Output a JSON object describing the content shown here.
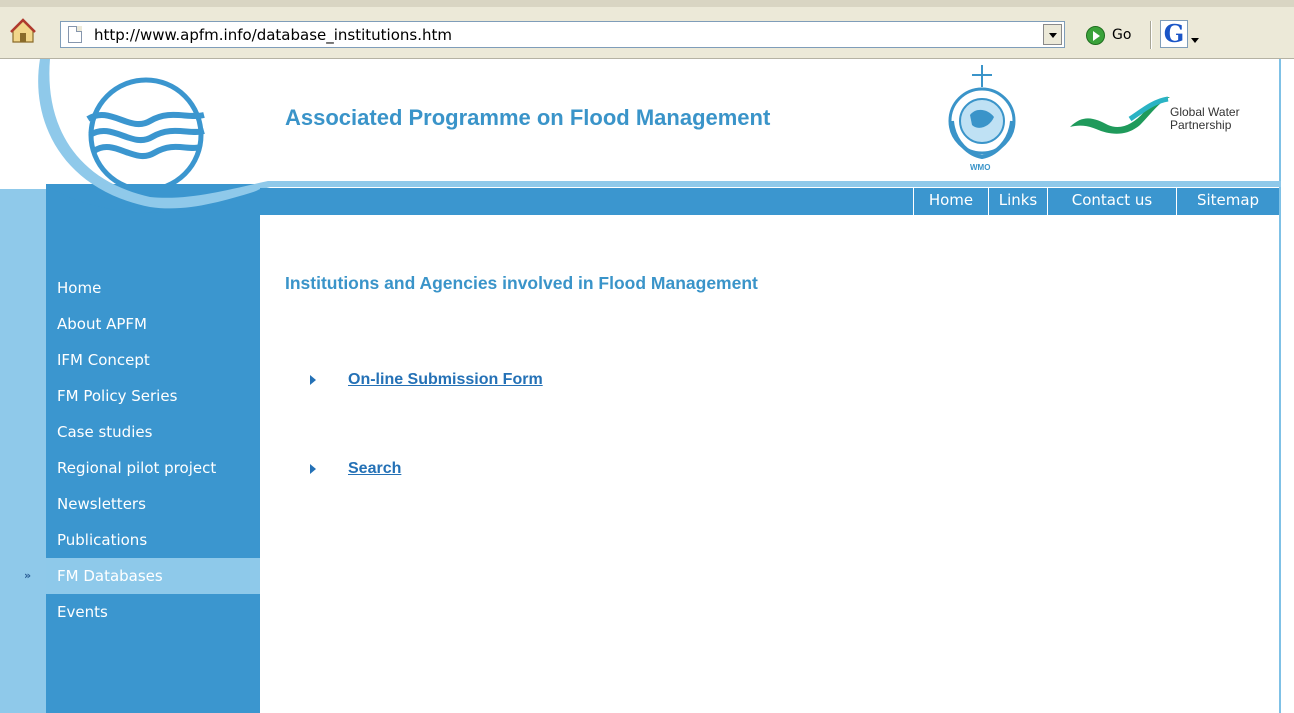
{
  "browser": {
    "url": "http://www.apfm.info/database_institutions.htm",
    "go_label": "Go",
    "google_label": "G"
  },
  "header": {
    "site_title": "Associated Programme on Flood Management",
    "wmo_label": "WMO",
    "gwp_label_line1": "Global Water",
    "gwp_label_line2": "Partnership"
  },
  "top_nav": {
    "items": [
      {
        "label": "Home"
      },
      {
        "label": "Links"
      },
      {
        "label": "Contact us"
      },
      {
        "label": "Sitemap"
      }
    ]
  },
  "sidebar": {
    "active_marker": "»",
    "items": [
      {
        "label": "Home"
      },
      {
        "label": "About APFM"
      },
      {
        "label": "IFM Concept"
      },
      {
        "label": "FM Policy Series"
      },
      {
        "label": "Case studies"
      },
      {
        "label": "Regional pilot project"
      },
      {
        "label": "Newsletters"
      },
      {
        "label": "Publications"
      },
      {
        "label": "FM Databases",
        "active": true
      },
      {
        "label": "Events"
      }
    ]
  },
  "content": {
    "title": "Institutions and Agencies involved in Flood Management",
    "links": [
      {
        "label": "On-line Submission Form"
      },
      {
        "label": "Search"
      }
    ]
  },
  "colors": {
    "brand_blue": "#3b96cf",
    "light_blue": "#8fc9ea",
    "title_blue": "#3a94c9",
    "link_blue": "#2471b6"
  }
}
